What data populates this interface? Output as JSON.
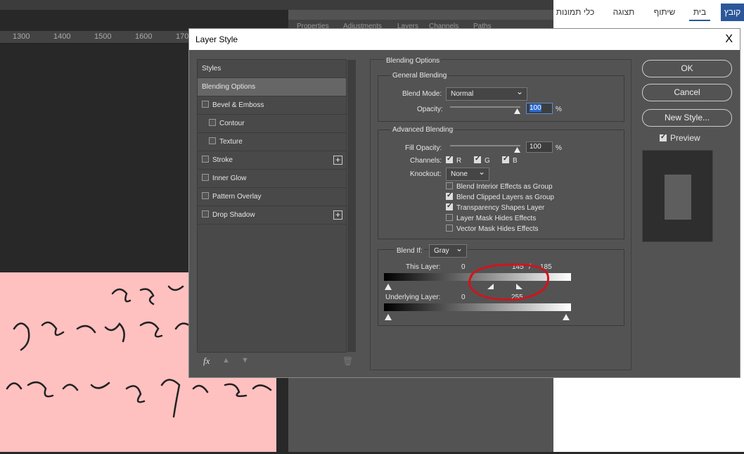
{
  "ruler": {
    "ticks": [
      "1300",
      "1400",
      "1500",
      "1600",
      "170"
    ]
  },
  "ps_panel_tabs": [
    "Properties",
    "Adjustments",
    "Layers",
    "Channels",
    "Paths"
  ],
  "word_ribbon": {
    "tabs": [
      "כלי תמונות",
      "תצוגה",
      "שיתוף",
      "בית",
      "קובץ"
    ],
    "active": "קובץ"
  },
  "dialog": {
    "title": "Layer Style",
    "close": "X",
    "styles_list": [
      {
        "label": "Styles",
        "checkbox": false,
        "selected": false
      },
      {
        "label": "Blending Options",
        "checkbox": false,
        "selected": true
      },
      {
        "label": "Bevel & Emboss",
        "checkbox": true,
        "checked": false
      },
      {
        "label": "Contour",
        "checkbox": true,
        "checked": false,
        "indent": true
      },
      {
        "label": "Texture",
        "checkbox": true,
        "checked": false,
        "indent": true
      },
      {
        "label": "Stroke",
        "checkbox": true,
        "checked": false,
        "plus": true
      },
      {
        "label": "Inner Glow",
        "checkbox": true,
        "checked": false
      },
      {
        "label": "Pattern Overlay",
        "checkbox": true,
        "checked": false
      },
      {
        "label": "Drop Shadow",
        "checkbox": true,
        "checked": false,
        "plus": true
      }
    ],
    "footer_icons": [
      "fx",
      "up-arrow",
      "down-arrow",
      "trash"
    ],
    "fx_label": "fx",
    "blending": {
      "title": "Blending Options",
      "general": {
        "title": "General Blending",
        "blend_mode_label": "Blend Mode:",
        "blend_mode": "Normal",
        "opacity_label": "Opacity:",
        "opacity": "100",
        "unit": "%"
      },
      "advanced": {
        "title": "Advanced Blending",
        "fill_opacity_label": "Fill Opacity:",
        "fill_opacity": "100",
        "unit": "%",
        "channels_label": "Channels:",
        "channels": [
          {
            "label": "R",
            "checked": true
          },
          {
            "label": "G",
            "checked": true
          },
          {
            "label": "B",
            "checked": true
          }
        ],
        "knockout_label": "Knockout:",
        "knockout": "None",
        "options": [
          {
            "label": "Blend Interior Effects as Group",
            "checked": false
          },
          {
            "label": "Blend Clipped Layers as Group",
            "checked": true
          },
          {
            "label": "Transparency Shapes Layer",
            "checked": true
          },
          {
            "label": "Layer Mask Hides Effects",
            "checked": false
          },
          {
            "label": "Vector Mask Hides Effects",
            "checked": false
          }
        ]
      },
      "blend_if": {
        "label": "Blend If:",
        "channel": "Gray",
        "this_layer_label": "This Layer:",
        "this_layer_low": "0",
        "this_layer_high_a": "145",
        "slash": "/",
        "this_layer_high_b": "185",
        "underlying_label": "Underlying Layer:",
        "underlying_low": "0",
        "underlying_high": "255"
      }
    },
    "buttons": {
      "ok": "OK",
      "cancel": "Cancel",
      "new_style": "New Style...",
      "preview_label": "Preview",
      "preview_checked": true
    },
    "annotation_color": "#d0141c"
  }
}
